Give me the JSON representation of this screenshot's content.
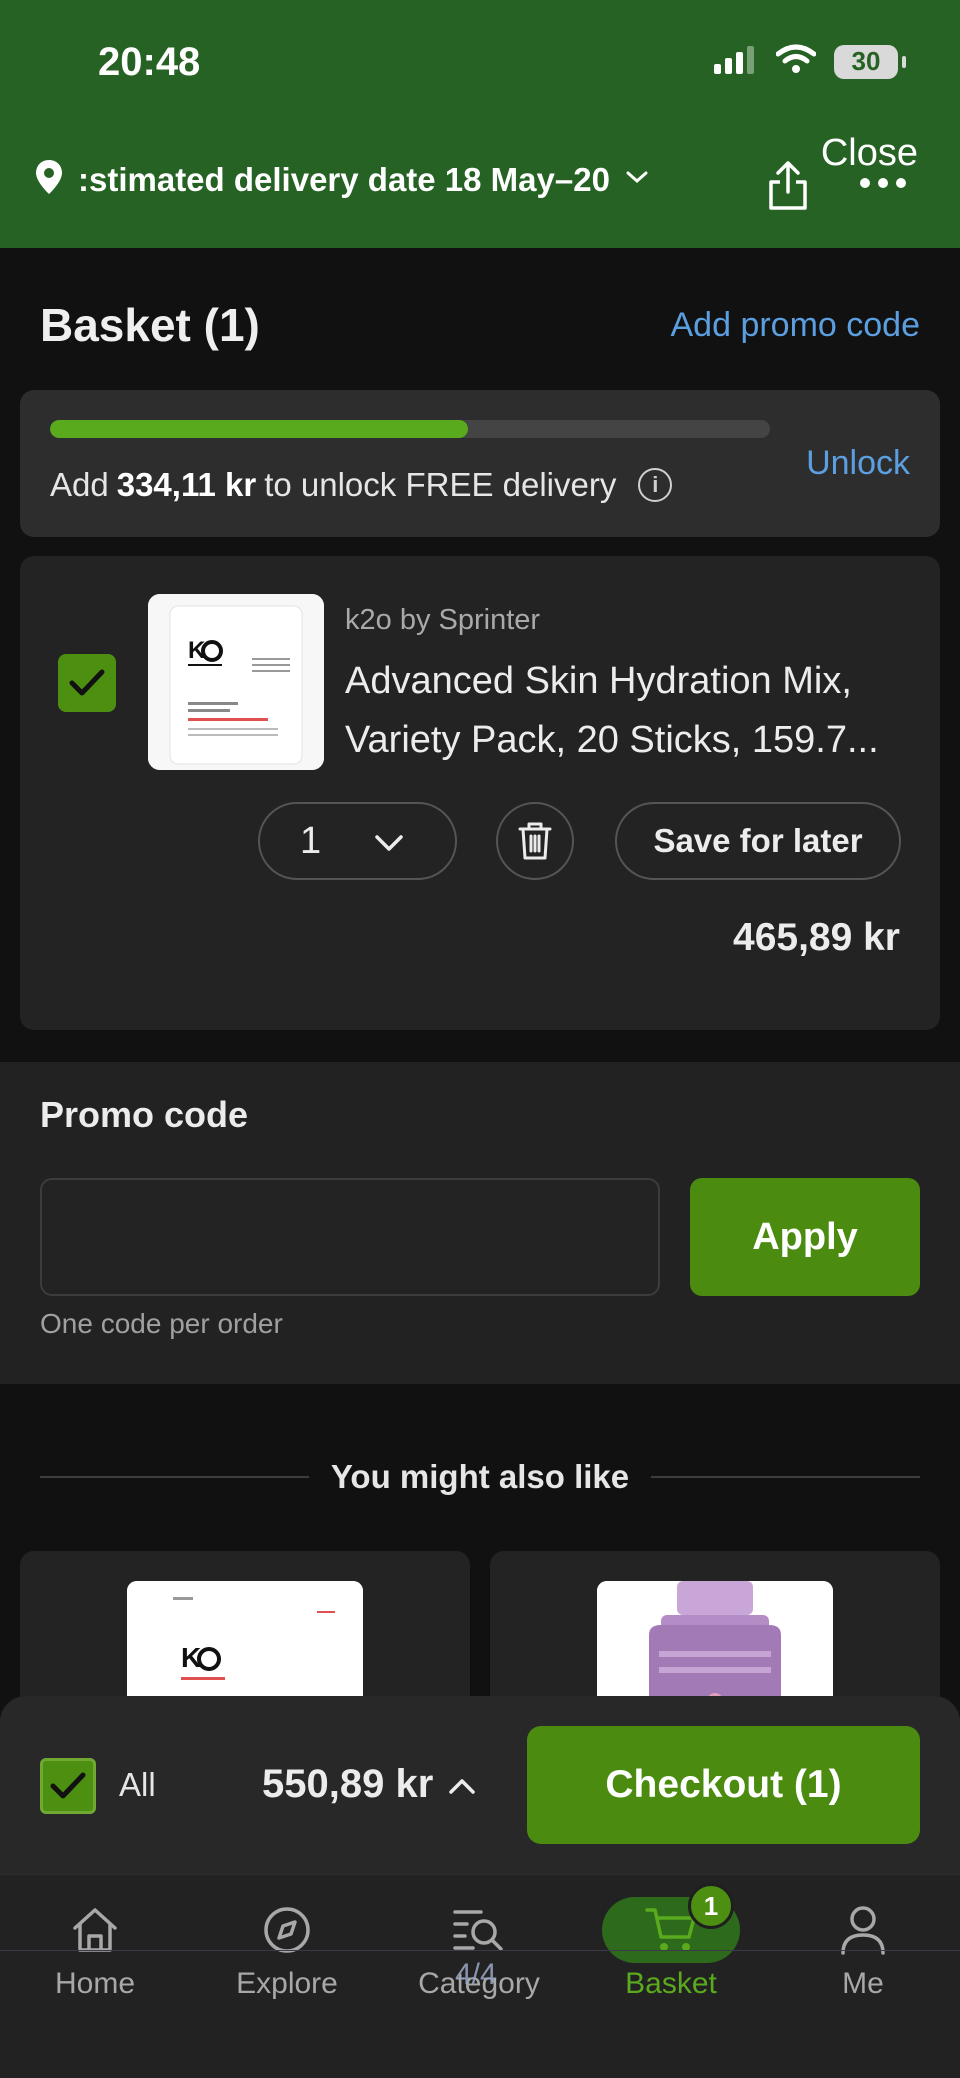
{
  "status_bar": {
    "time": "20:48",
    "battery": "30"
  },
  "header": {
    "delivery_text": ":stimated delivery date 18 May–20",
    "close_label": "Close",
    "colors": {
      "background": "#266223"
    }
  },
  "basket": {
    "title": "Basket (1)",
    "add_promo_label": "Add promo code"
  },
  "free_delivery": {
    "prefix": "Add ",
    "amount": "334,11 kr",
    "suffix": " to unlock FREE delivery",
    "unlock_label": "Unlock",
    "progress_percent": 58
  },
  "item": {
    "brand": "k2o by Sprinter",
    "title": "Advanced Skin Hydration Mix, Variety Pack, 20 Sticks, 159.7...",
    "quantity": "1",
    "save_for_later_label": "Save for later",
    "price": "465,89 kr",
    "selected": true
  },
  "promo": {
    "heading": "Promo code",
    "input_value": "",
    "apply_label": "Apply",
    "hint": "One code per order"
  },
  "recommendations": {
    "title": "You might also like"
  },
  "checkout_bar": {
    "all_label": "All",
    "total": "550,89 kr",
    "checkout_label": "Checkout (1)"
  },
  "tabbar": {
    "items": [
      {
        "label": "Home",
        "icon": "home-icon"
      },
      {
        "label": "Explore",
        "icon": "compass-icon"
      },
      {
        "label": "Category",
        "icon": "category-search-icon"
      },
      {
        "label": "Basket",
        "icon": "cart-icon",
        "badge": "1",
        "active": true
      },
      {
        "label": "Me",
        "icon": "person-icon"
      }
    ],
    "page_indicator": "4/4"
  },
  "colors": {
    "accent": "#4b8c10",
    "link": "#5b9fe0",
    "progress": "#5aaa1e"
  }
}
